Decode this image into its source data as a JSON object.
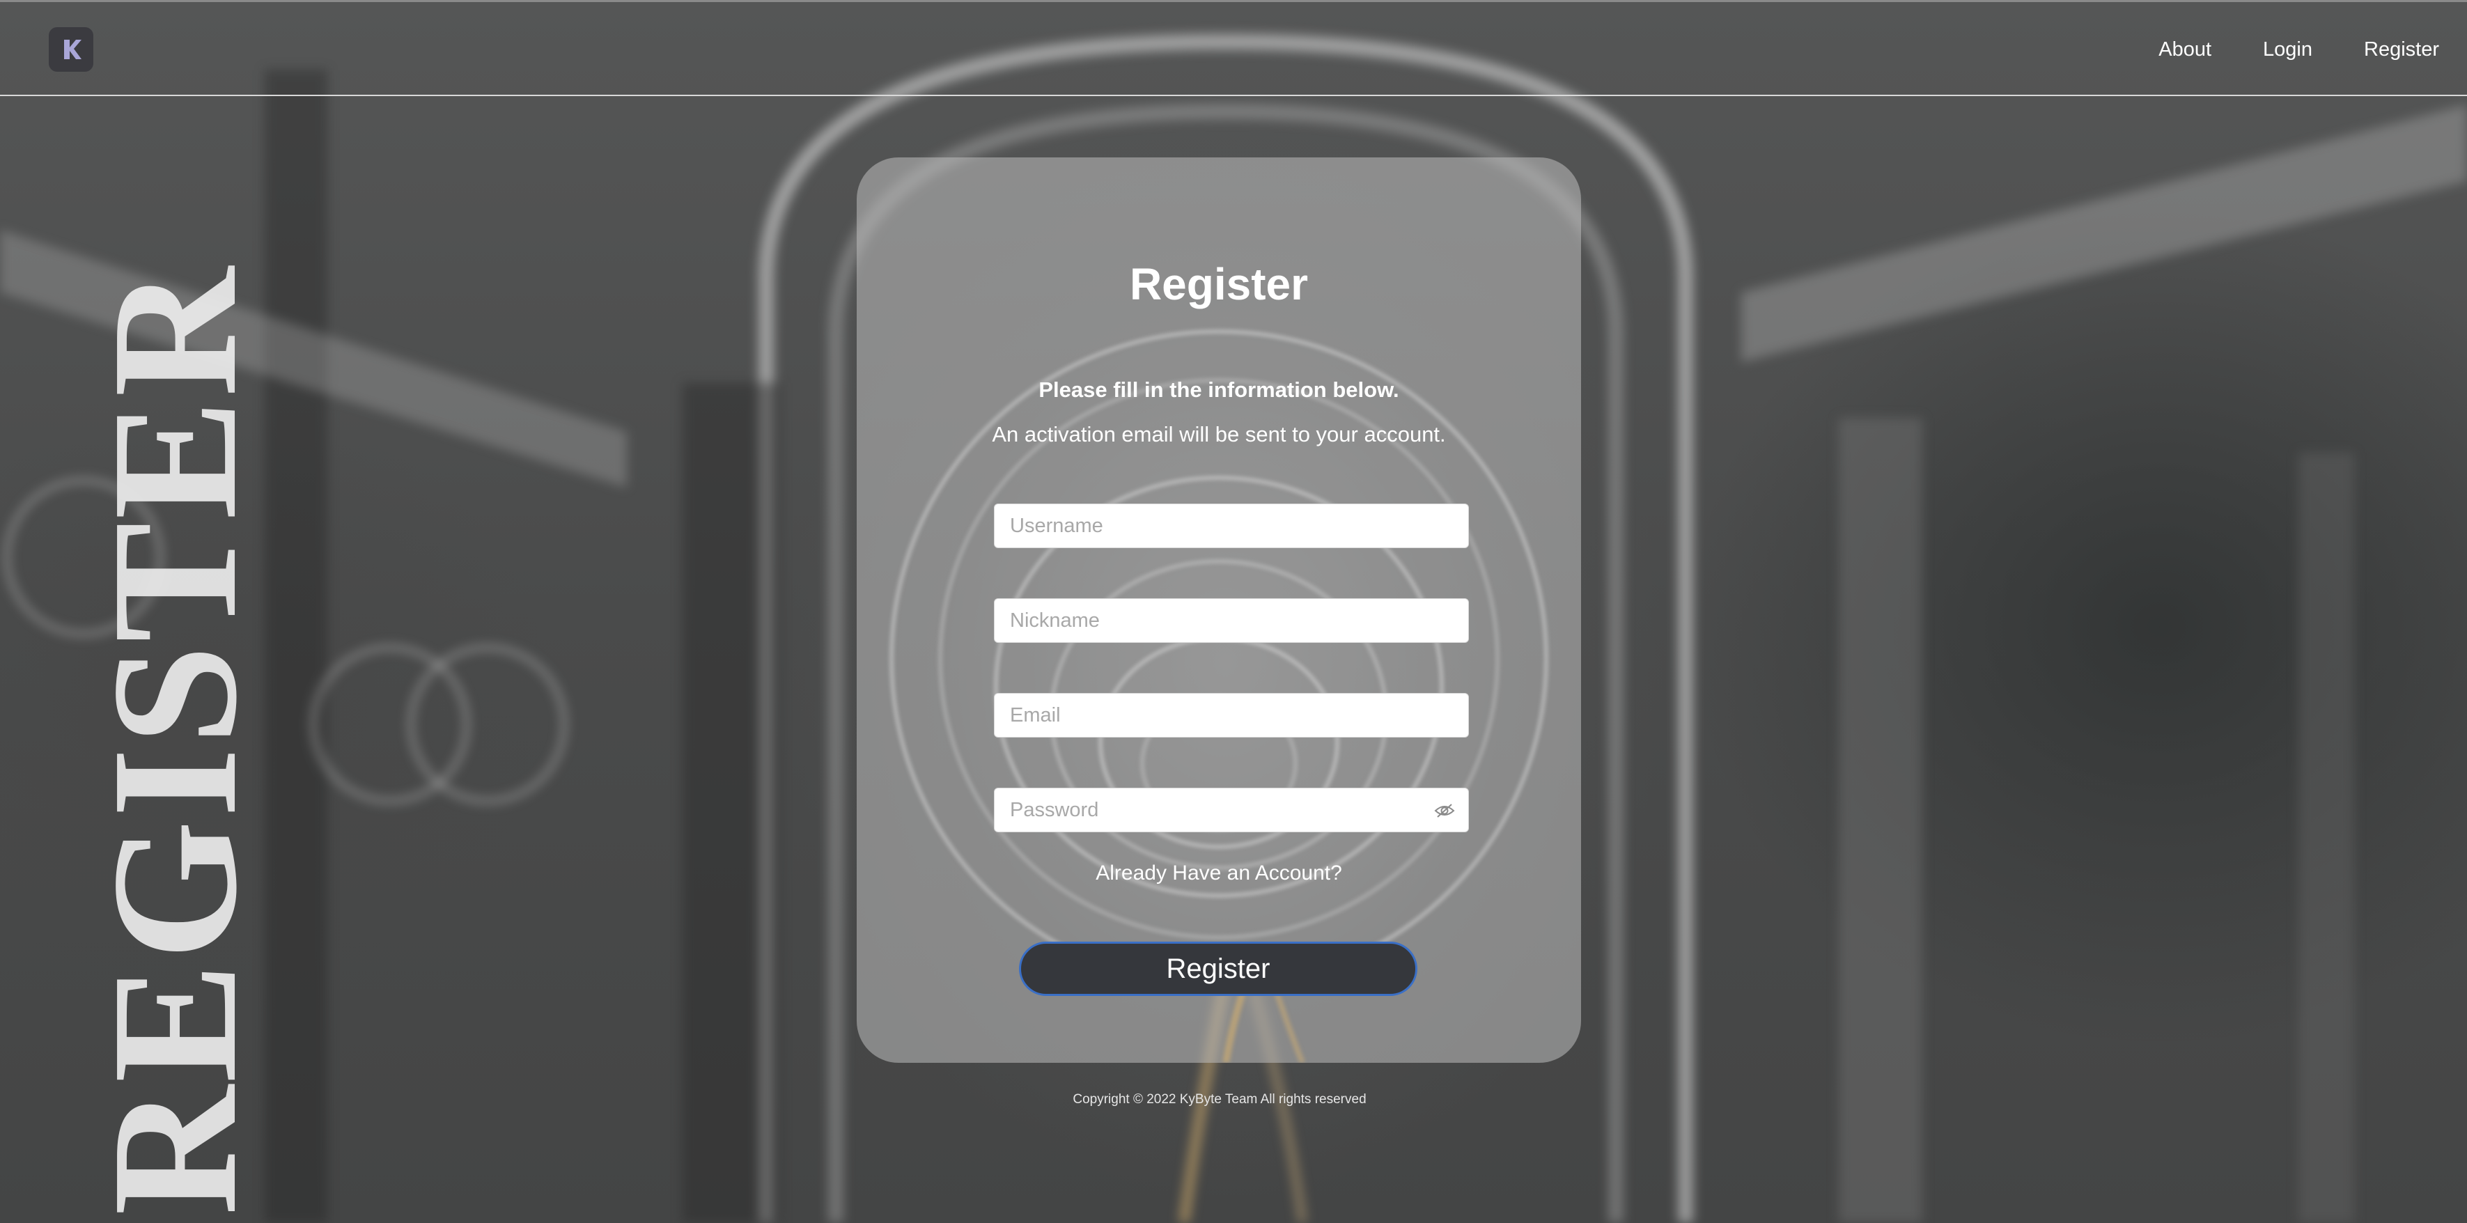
{
  "header": {
    "logo_icon": "k-logo-icon",
    "nav": [
      {
        "label": "About"
      },
      {
        "label": "Login"
      },
      {
        "label": "Register"
      }
    ]
  },
  "side_word": "REGISTER",
  "form": {
    "title": "Register",
    "subtitle_bold": "Please fill in the information below.",
    "subtitle": "An activation email will be sent to your account.",
    "username_placeholder": "Username",
    "nickname_placeholder": "Nickname",
    "email_placeholder": "Email",
    "password_placeholder": "Password",
    "password_toggle_icon": "eye-slash-icon",
    "already_account_label": "Already Have an Account?",
    "submit_label": "Register"
  },
  "footer": {
    "copyright": "Copyright © 2022 KyByte Team All rights reserved"
  },
  "colors": {
    "button_bg": "#35373c",
    "button_border": "#3a6fc6",
    "background": "#4d4e4e"
  }
}
